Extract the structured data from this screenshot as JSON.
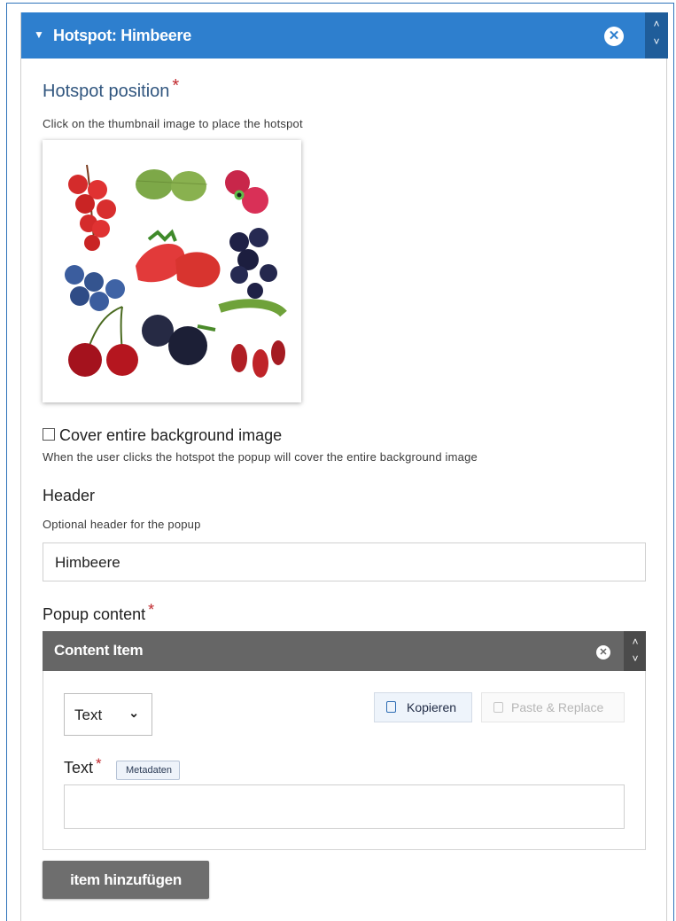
{
  "hotspot_header": {
    "title": "Hotspot: Himbeere",
    "caret": "▼",
    "close_icon": "close-circle-icon",
    "up_icon": "˄",
    "down_icon": "˅"
  },
  "position": {
    "label": "Hotspot position",
    "required_mark": "*",
    "description": "Click on the thumbnail image to place the hotspot"
  },
  "cover": {
    "label": "Cover entire background image",
    "checked": false,
    "description": "When the user clicks the hotspot the popup will cover the entire background image"
  },
  "header_field": {
    "label": "Header",
    "description": "Optional header for the popup",
    "value": "Himbeere"
  },
  "popup": {
    "label": "Popup content",
    "required_mark": "*",
    "content_item": {
      "title": "Content Item",
      "type_select": "Text",
      "copy_button": "Kopieren",
      "paste_button": "Paste & Replace",
      "text_label": "Text",
      "required_mark": "*",
      "metadata_button": "Metadaten",
      "text_value": ""
    },
    "add_button": "item hinzufügen"
  },
  "colors": {
    "accent": "#2e7fce",
    "required": "#c0282d",
    "content_header": "#666666"
  }
}
